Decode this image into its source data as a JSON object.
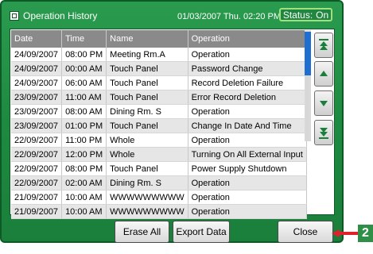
{
  "window": {
    "title": "Operation History",
    "datetime": "01/03/2007 Thu. 02:20 PM",
    "status_label": "Status:",
    "status_value": "On"
  },
  "table": {
    "headers": [
      "Date",
      "Time",
      "Name",
      "Operation"
    ],
    "rows": [
      [
        "24/09/2007",
        "08:00 PM",
        "Meeting Rm.A",
        "Operation"
      ],
      [
        "24/09/2007",
        "00:00 AM",
        "Touch Panel",
        "Password Change"
      ],
      [
        "24/09/2007",
        "06:00 AM",
        "Touch Panel",
        "Record Deletion Failure"
      ],
      [
        "23/09/2007",
        "11:00 AM",
        "Touch Panel",
        "Error Record Deletion"
      ],
      [
        "23/09/2007",
        "08:00 AM",
        "Dining Rm. S",
        "Operation"
      ],
      [
        "23/09/2007",
        "01:00 PM",
        "Touch Panel",
        "Change In Date And Time"
      ],
      [
        "22/09/2007",
        "11:00 PM",
        "Whole",
        "Operation"
      ],
      [
        "22/09/2007",
        "12:00 PM",
        "Whole",
        "Turning On All External Input"
      ],
      [
        "22/09/2007",
        "08:00 PM",
        "Touch Panel",
        "Power Supply Shutdown"
      ],
      [
        "22/09/2007",
        "02:00 AM",
        "Dining Rm. S",
        "Operation"
      ],
      [
        "21/09/2007",
        "10:00 AM",
        "WWWWWWWWW",
        "Operation"
      ],
      [
        "21/09/2007",
        "10:00 AM",
        "WWWWWWWWW",
        "Operation"
      ]
    ]
  },
  "buttons": {
    "erase_all": "Erase All",
    "export_data": "Export Data",
    "close": "Close"
  },
  "callout": {
    "number": "2"
  },
  "colors": {
    "panel_green": "#1e8a41",
    "header_gray": "#8a8a8a",
    "status_border": "#9fe07f",
    "callout_red": "#e0202a",
    "scroll_blue": "#1f6fd0"
  }
}
